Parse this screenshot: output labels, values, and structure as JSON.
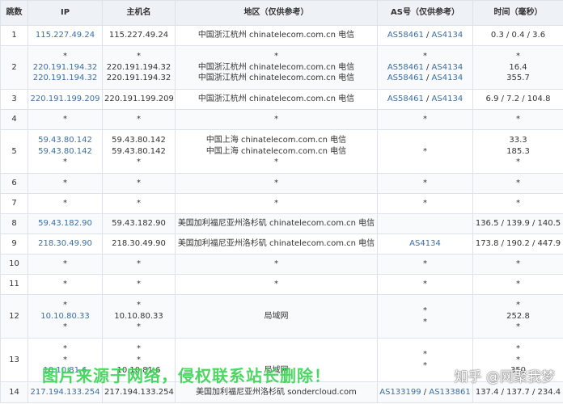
{
  "headers": [
    "跳数",
    "IP",
    "主机名",
    "地区（仅供参考）",
    "AS号（仅供参考）",
    "时间（毫秒）"
  ],
  "rows": [
    {
      "hop": "1",
      "ip": [
        "115.227.49.24"
      ],
      "host": [
        "115.227.49.24"
      ],
      "region": [
        "中国浙江杭州 chinatelecom.com.cn 电信"
      ],
      "as": [
        [
          "AS58461",
          "AS4134"
        ]
      ],
      "time": [
        "0.3 / 0.4 / 3.6"
      ],
      "h": 25
    },
    {
      "hop": "2",
      "ip": [
        "*",
        "220.191.194.32",
        "220.191.194.32"
      ],
      "host": [
        "*",
        "220.191.194.32",
        "220.191.194.32"
      ],
      "region": [
        "*",
        "中国浙江杭州 chinatelecom.com.cn 电信",
        "中国浙江杭州 chinatelecom.com.cn 电信"
      ],
      "as": [
        [
          "*"
        ],
        [
          "AS58461",
          "AS4134"
        ],
        [
          "AS58461",
          "AS4134"
        ]
      ],
      "time": [
        "*",
        "16.4",
        "355.7"
      ],
      "h": 54
    },
    {
      "hop": "3",
      "ip": [
        "220.191.199.209"
      ],
      "host": [
        "220.191.199.209"
      ],
      "region": [
        "中国浙江杭州 chinatelecom.com.cn 电信"
      ],
      "as": [
        [
          "AS58461",
          "AS4134"
        ]
      ],
      "time": [
        "6.9 / 7.2 / 104.8"
      ],
      "h": 25
    },
    {
      "hop": "4",
      "ip": [
        "*"
      ],
      "host": [
        "*"
      ],
      "region": [
        "*"
      ],
      "as": [
        [
          "*"
        ]
      ],
      "time": [
        "*"
      ],
      "h": 25
    },
    {
      "hop": "5",
      "ip": [
        "59.43.80.142",
        "59.43.80.142",
        "*"
      ],
      "host": [
        "59.43.80.142",
        "59.43.80.142",
        "*"
      ],
      "region": [
        "中国上海 chinatelecom.com.cn 电信",
        "中国上海 chinatelecom.com.cn 电信",
        "*"
      ],
      "as": [
        [
          ""
        ],
        [
          ""
        ],
        [
          "*"
        ]
      ],
      "time": [
        "33.3",
        "185.3",
        "*"
      ],
      "h": 54
    },
    {
      "hop": "6",
      "ip": [
        "*"
      ],
      "host": [
        "*"
      ],
      "region": [
        "*"
      ],
      "as": [
        [
          "*"
        ]
      ],
      "time": [
        "*"
      ],
      "h": 25
    },
    {
      "hop": "7",
      "ip": [
        "*"
      ],
      "host": [
        "*"
      ],
      "region": [
        "*"
      ],
      "as": [
        [
          "*"
        ]
      ],
      "time": [
        "*"
      ],
      "h": 25
    },
    {
      "hop": "8",
      "ip": [
        "59.43.182.90"
      ],
      "host": [
        "59.43.182.90"
      ],
      "region": [
        "美国加利福尼亚州洛杉矶 chinatelecom.com.cn 电信"
      ],
      "as": [
        [
          ""
        ]
      ],
      "time": [
        "136.5 / 139.9 / 140.5"
      ],
      "h": 25
    },
    {
      "hop": "9",
      "ip": [
        "218.30.49.90"
      ],
      "host": [
        "218.30.49.90"
      ],
      "region": [
        "美国加利福尼亚州洛杉矶 chinatelecom.com.cn 电信"
      ],
      "as": [
        [
          "AS4134"
        ]
      ],
      "time": [
        "173.8 / 190.2 / 447.9"
      ],
      "h": 25
    },
    {
      "hop": "10",
      "ip": [
        "*"
      ],
      "host": [
        "*"
      ],
      "region": [
        "*"
      ],
      "as": [
        [
          "*"
        ]
      ],
      "time": [
        "*"
      ],
      "h": 25
    },
    {
      "hop": "11",
      "ip": [
        "*"
      ],
      "host": [
        "*"
      ],
      "region": [
        "*"
      ],
      "as": [
        [
          "*"
        ]
      ],
      "time": [
        "*"
      ],
      "h": 25
    },
    {
      "hop": "12",
      "ip": [
        "*",
        "10.10.80.33",
        "*"
      ],
      "host": [
        "*",
        "10.10.80.33",
        "*"
      ],
      "region": [
        "",
        "局域网",
        ""
      ],
      "as": [
        [
          "*"
        ],
        [
          ""
        ],
        [
          "*"
        ]
      ],
      "time": [
        "*",
        "252.8",
        "*"
      ],
      "h": 54
    },
    {
      "hop": "13",
      "ip": [
        "*",
        "*",
        "10.10.81.6"
      ],
      "host": [
        "*",
        "*",
        "10.10.81.6"
      ],
      "region": [
        "",
        "",
        "局域网"
      ],
      "as": [
        [
          "*"
        ],
        [
          "*"
        ],
        [
          ""
        ]
      ],
      "time": [
        "*",
        "*",
        "350"
      ],
      "h": 54
    },
    {
      "hop": "14",
      "ip": [
        "217.194.133.254"
      ],
      "host": [
        "217.194.133.254"
      ],
      "region": [
        "美国加利福尼亚州洛杉矶 sondercloud.com"
      ],
      "as": [
        [
          "AS133199",
          "AS133861"
        ]
      ],
      "time": [
        "137.4 / 137.7 / 234.4"
      ],
      "h": 26
    }
  ],
  "watermark": "图片来源于网络，侵权联系站长删除！",
  "zhihu_mark": "知乎 @网聚我梦",
  "colors": {
    "link": "#3a6ea5",
    "header_bg": "#eef2f7",
    "watermark": "#39d353"
  }
}
